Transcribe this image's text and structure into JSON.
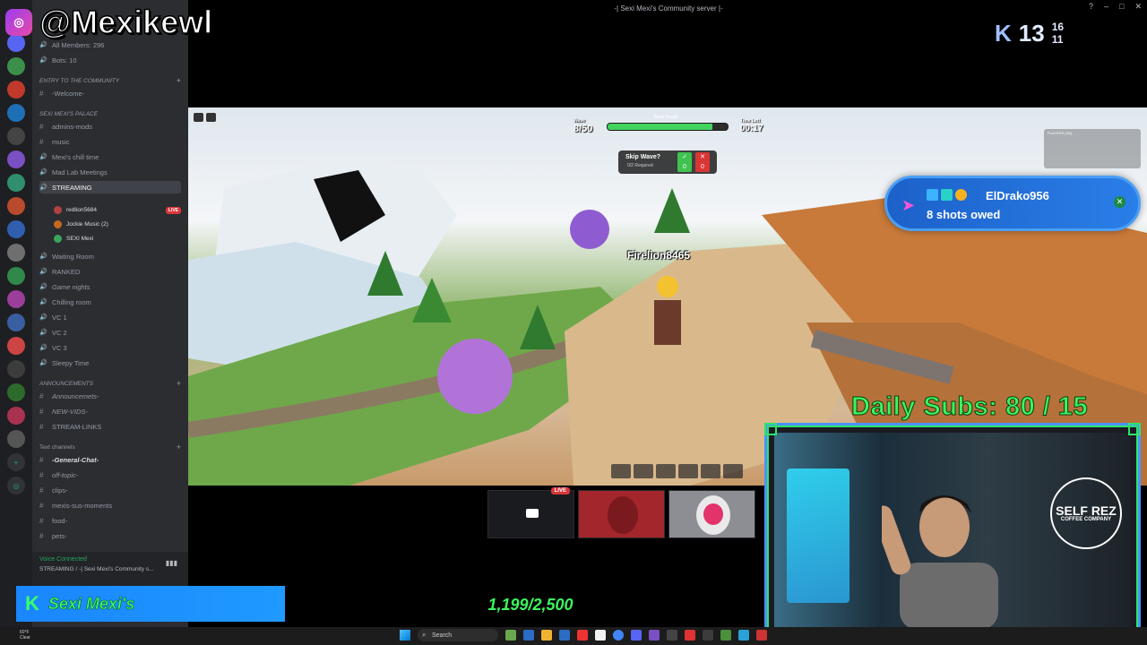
{
  "window": {
    "title": "-| Sexi Mexi's Community server |-"
  },
  "overlay": {
    "handle": "@Mexikewl",
    "stat_k": "K",
    "stat_main": "13",
    "stat_top": "16",
    "stat_bottom": "11",
    "daily_subs": "Daily Subs: 80 / 15",
    "name_banner_k": "K",
    "name_banner": "Sexi Mexi's",
    "goal": "1,199/2,500"
  },
  "alert": {
    "name": "ElDrako956",
    "message": "8 shots owed"
  },
  "sidebar": {
    "members": "All Members: 296",
    "bots": "Bots: 10",
    "cat_entry": "ENTRY TO THE COMMUNITY",
    "welcome": "-Welcome-",
    "cat_palace": "SEXI MEXI'S PALACE",
    "admins": "admins-mods",
    "music": "music",
    "chill": "Mexi's chill time",
    "madlab": "Mad Lab Meetings",
    "streaming": "STREAMING",
    "user1": "redlion5684",
    "user1_live": "LIVE",
    "user2": "Jockie Music (2)",
    "user3": "SEXI Mexi",
    "waiting": "Waiting Room",
    "ranked": "RANKED",
    "gamenights": "Game nights",
    "chilling": "Chilling room",
    "vc1": "VC 1",
    "vc2": "VC 2",
    "vc3": "VC 3",
    "sleepy": "Sleepy Time",
    "cat_announce": "ANNOUNCEMENTS",
    "announcements": "Announcemets-",
    "newvids": "NEW-VIDS-",
    "streamlinks": "STREAM-LINKS",
    "cat_text": "Text channels",
    "general": "-General-Chat-",
    "offtopic": "off-topic-",
    "clips": "clips-",
    "susmoments": "mexis-sus-moments",
    "food": "food-",
    "pets": "pets-",
    "voice_connected": "Voice Connected",
    "voice_channel": "STREAMING / -| Sexi Mexi's Community s..."
  },
  "game": {
    "wave_label": "Wave",
    "wave": "8/50",
    "base_health": "Base Health",
    "health_pct": 0.87,
    "timer_label": "Time Left",
    "timer": "00:17",
    "skip_title": "Skip Wave?",
    "skip_req": "0/2 Required",
    "skip_yes": "0",
    "skip_no": "0",
    "player_name": "Firelion8465",
    "players_header": "PLAYERS (3/4)"
  },
  "tiles": {
    "live": "LIVE"
  },
  "taskbar": {
    "temp": "60°F",
    "weather": "Clear",
    "search": "Search"
  },
  "colors": {
    "accent_green": "#3bf560",
    "accent_blue": "#1f8bff",
    "discord_bg": "#2b2d31"
  }
}
